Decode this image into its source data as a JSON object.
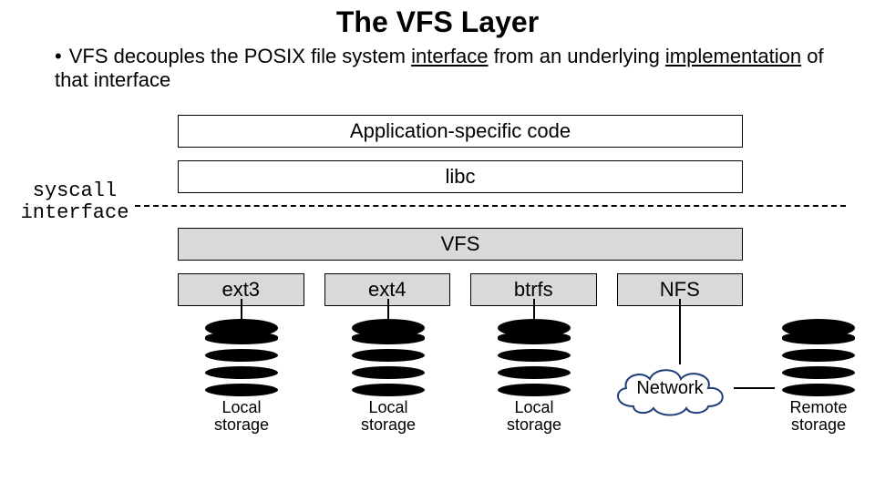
{
  "title": "The VFS Layer",
  "bullet_prefix": "VFS decouples the POSIX file system ",
  "bullet_em1": "interface",
  "bullet_mid": " from an underlying ",
  "bullet_em2": "implementation",
  "bullet_suffix": " of that interface",
  "layers": {
    "app": "Application-specific code",
    "libc": "libc",
    "vfs": "VFS"
  },
  "fs": [
    "ext3",
    "ext4",
    "btrfs",
    "NFS"
  ],
  "syscall_label_1": "syscall",
  "syscall_label_2": "interface",
  "network_label": "Network",
  "storage": {
    "local": "Local storage",
    "remote": "Remote storage"
  }
}
